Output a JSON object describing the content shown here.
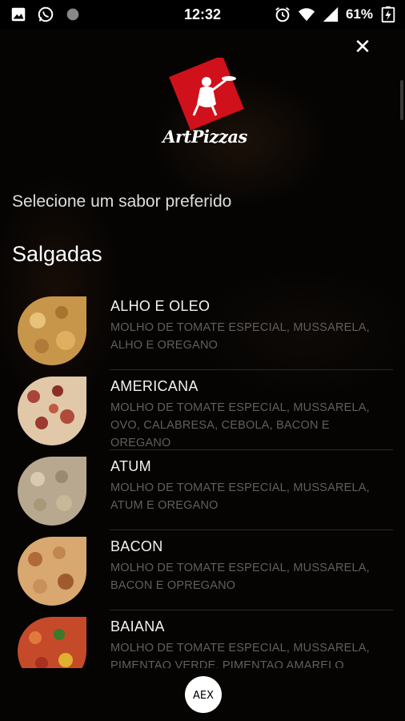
{
  "status_bar": {
    "time": "12:32",
    "battery": "61%",
    "left_icons": [
      "image-icon",
      "whatsapp-icon",
      "dot-icon"
    ],
    "right_icons": [
      "alarm-icon",
      "wifi-icon",
      "signal-icon",
      "battery-icon"
    ]
  },
  "brand": {
    "name": "ArtPizzas",
    "accent": "#d0101a"
  },
  "header": {
    "subtitle": "Selecione um sabor preferido",
    "close_icon": "close-icon"
  },
  "section": {
    "title": "Salgadas"
  },
  "items": [
    {
      "name": "ALHO E OLEO",
      "desc": "MOLHO DE TOMATE ESPECIAL, MUSSARELA, ALHO E OREGANO",
      "thumb_color": "#c8964a"
    },
    {
      "name": "AMERICANA",
      "desc": "MOLHO DE TOMATE ESPECIAL, MUSSARELA, OVO, CALABRESA, CEBOLA, BACON E OREGANO",
      "thumb_color": "#a8443a"
    },
    {
      "name": "ATUM",
      "desc": "MOLHO DE TOMATE ESPECIAL, MUSSARELA, ATUM E OREGANO",
      "thumb_color": "#b8a890"
    },
    {
      "name": "BACON",
      "desc": "MOLHO DE TOMATE ESPECIAL, MUSSARELA, BACON E OPREGANO",
      "thumb_color": "#c08850"
    },
    {
      "name": "BAIANA",
      "desc": "MOLHO DE TOMATE ESPECIAL, MUSSARELA, PIMENTAO VERDE, PIMENTAO AMARELO",
      "thumb_color": "#c44a2a"
    }
  ],
  "footer": {
    "logo_icon": "aex-logo-icon",
    "logo_text": "AEX"
  }
}
